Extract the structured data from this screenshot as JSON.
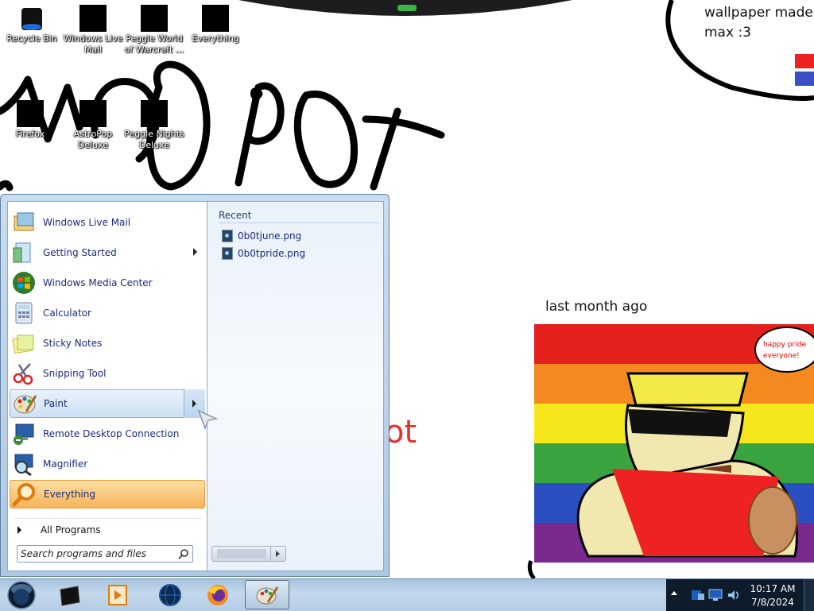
{
  "desktop": {
    "icons": [
      {
        "label": "Recycle Bin"
      },
      {
        "label": "Windows Live Mail"
      },
      {
        "label": "Peggle World of Warcraft ..."
      },
      {
        "label": "Everything"
      },
      {
        "label": "Firefox"
      },
      {
        "label": "AstroPop Deluxe"
      },
      {
        "label": "Peggle Nights Deluxe"
      }
    ],
    "wallpaper_text": {
      "line1": "wallpaper made",
      "line2": "max :3",
      "caption": "last month ago",
      "red_fragment": "ot",
      "speech": "happy pride everyone!"
    }
  },
  "start_menu": {
    "programs": [
      {
        "label": "Windows Live Mail",
        "icon": "mail-icon"
      },
      {
        "label": "Getting Started",
        "icon": "getting-started-icon",
        "submenu": true
      },
      {
        "label": "Windows Media Center",
        "icon": "media-center-icon"
      },
      {
        "label": "Calculator",
        "icon": "calculator-icon"
      },
      {
        "label": "Sticky Notes",
        "icon": "sticky-notes-icon"
      },
      {
        "label": "Snipping Tool",
        "icon": "scissors-icon"
      },
      {
        "label": "Paint",
        "icon": "paint-palette-icon",
        "submenu": true,
        "hovered": true
      },
      {
        "label": "Remote Desktop Connection",
        "icon": "remote-desktop-icon"
      },
      {
        "label": "Magnifier",
        "icon": "magnifier-icon"
      },
      {
        "label": "Everything",
        "icon": "everything-search-icon",
        "highlighted": true
      }
    ],
    "all_programs": "All Programs",
    "search_placeholder": "Search programs and files",
    "recent": {
      "title": "Recent",
      "items": [
        "0b0tjune.png",
        "0b0tpride.png"
      ]
    }
  },
  "taskbar": {
    "clock_time": "10:17 AM",
    "clock_date": "7/8/2024",
    "pinned": [
      "dark-app-icon",
      "media-player-icon",
      "globe-icon",
      "firefox-icon",
      "paint-icon"
    ]
  },
  "colors": {
    "link_text": "#1b2a7a",
    "pinned_highlight": "#f6b35a",
    "taskbar": "#b5cde5"
  }
}
